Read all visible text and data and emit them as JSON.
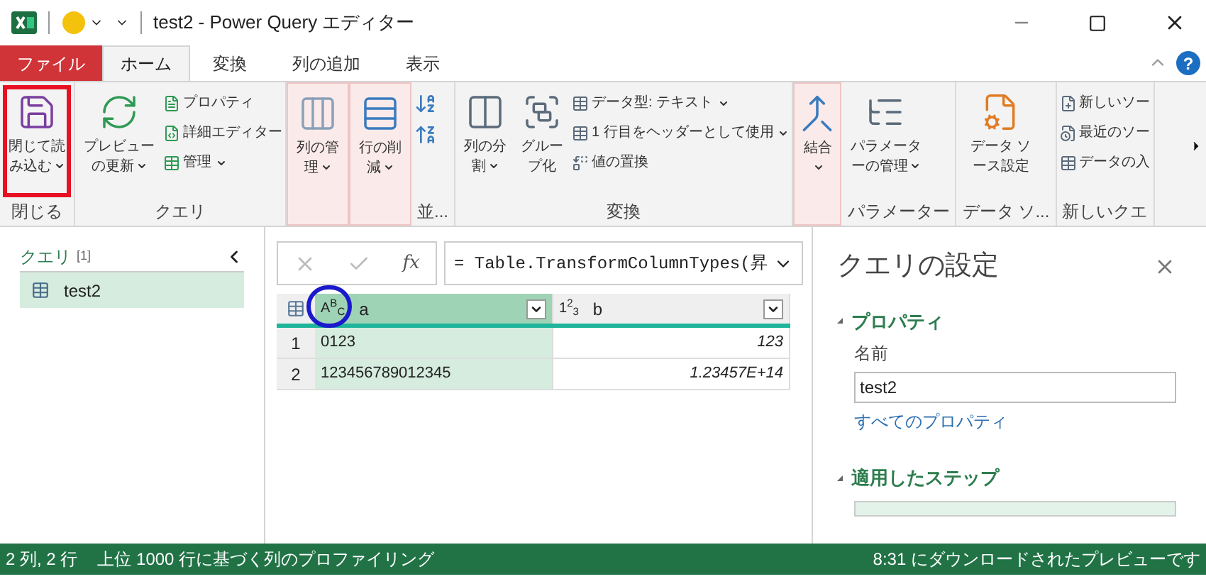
{
  "window": {
    "title": "test2 - Power Query エディター",
    "help": "?"
  },
  "tabs": [
    {
      "label": "ファイル",
      "kind": "file",
      "selected": false
    },
    {
      "label": "ホーム",
      "kind": "tab",
      "selected": true
    },
    {
      "label": "変換",
      "kind": "tab",
      "selected": false
    },
    {
      "label": "列の追加",
      "kind": "tab",
      "selected": false
    },
    {
      "label": "表示",
      "kind": "tab",
      "selected": false
    }
  ],
  "ribbon": [
    {
      "label": "閉じる",
      "highlighted": false,
      "items": [
        {
          "kind": "large",
          "label": "閉じて読み込む",
          "dropdown": true,
          "outlined": true
        }
      ]
    },
    {
      "label": "クエリ",
      "highlighted": false,
      "items": [
        {
          "kind": "large",
          "label": "プレビューの更新",
          "dropdown": true,
          "outlined": false
        },
        {
          "kind": "small",
          "label": "プロパティ",
          "dropdown": false
        },
        {
          "kind": "small",
          "label": "詳細エディター",
          "dropdown": false
        },
        {
          "kind": "small",
          "label": "管理",
          "dropdown": true
        }
      ]
    },
    {
      "highlighted": true,
      "items": [
        {
          "kind": "large",
          "label": "列の管理",
          "dropdown": true,
          "outlined": false
        }
      ]
    },
    {
      "highlighted": true,
      "items": [
        {
          "kind": "large",
          "label": "行の削減",
          "dropdown": true,
          "outlined": false
        }
      ]
    },
    {
      "label": "並...",
      "highlighted": false,
      "items": [
        {
          "kind": "icon"
        },
        {
          "kind": "icon"
        }
      ]
    },
    {
      "label": "変換",
      "highlighted": false,
      "items": [
        {
          "kind": "large",
          "label": "列の分割",
          "dropdown": true,
          "outlined": false
        },
        {
          "kind": "large",
          "label": "グループ化",
          "dropdown": false,
          "outlined": false
        },
        {
          "kind": "small",
          "label": "データ型: テキスト",
          "dropdown": true
        },
        {
          "kind": "small",
          "label": "1 行目をヘッダーとして使用",
          "dropdown": true
        },
        {
          "kind": "small",
          "label": "値の置換",
          "dropdown": false
        }
      ]
    },
    {
      "highlighted": true,
      "items": [
        {
          "kind": "large",
          "label": "結合",
          "dropdown": true,
          "outlined": false
        }
      ]
    },
    {
      "label": "パラメーター",
      "highlighted": false,
      "items": [
        {
          "kind": "large",
          "label": "パラメーターの管理",
          "dropdown": true,
          "outlined": false
        }
      ]
    },
    {
      "label": "データ ソ...",
      "highlighted": false,
      "items": [
        {
          "kind": "large",
          "label": "データ ソース設定",
          "dropdown": false,
          "outlined": false
        }
      ]
    },
    {
      "label": "新しいクエ",
      "highlighted": false,
      "items": [
        {
          "kind": "small",
          "label": "新しいソー",
          "dropdown": false
        },
        {
          "kind": "small",
          "label": "最近のソー",
          "dropdown": false
        },
        {
          "kind": "small",
          "label": "データの入",
          "dropdown": false
        }
      ]
    }
  ],
  "queries": {
    "title": "クエリ",
    "count": "[1]",
    "items": [
      {
        "name": "test2",
        "selected": true
      }
    ]
  },
  "formula": {
    "function_label": "fx",
    "value": "= Table.TransformColumnTypes(昇"
  },
  "table": {
    "columns": [
      {
        "name": "a",
        "type": "A$^{B}$$_{C}$",
        "kind": "text",
        "selected": true,
        "circled": true
      },
      {
        "name": "b",
        "type": "1$^{2}$$_{3}$",
        "kind": "number",
        "selected": false,
        "circled": false
      }
    ],
    "rows": [
      {
        "index": "1",
        "cells": [
          "0123",
          "123"
        ]
      },
      {
        "index": "2",
        "cells": [
          "123456789012345",
          "1.23457E+14"
        ]
      }
    ]
  },
  "settings": {
    "title": "クエリの設定",
    "properties_heading": "プロパティ",
    "name_label": "名前",
    "name_value": "test2",
    "all_properties_link": "すべてのプロパティ",
    "steps_heading": "適用したステップ"
  },
  "status_bar": {
    "left": [
      "2 列, 2 行",
      "上位 1000 行に基づく列のプロファイリング"
    ],
    "right": "8:31 にダウンロードされたプレビューです"
  }
}
